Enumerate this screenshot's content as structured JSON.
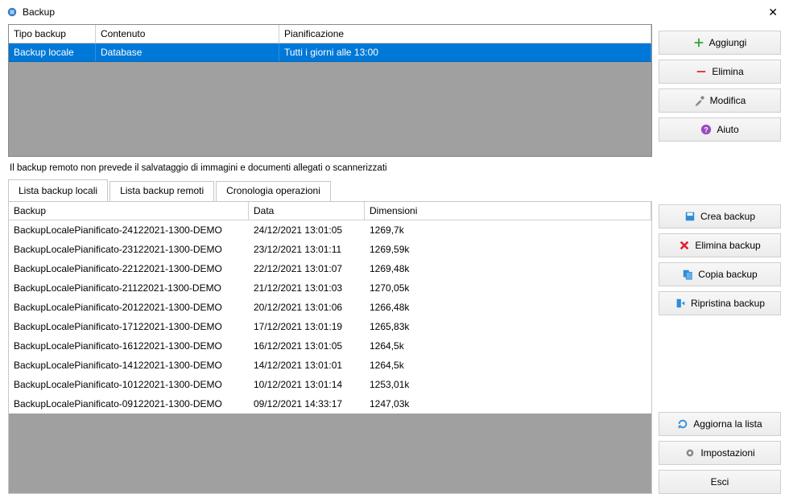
{
  "window": {
    "title": "Backup"
  },
  "top_table": {
    "headers": {
      "tipo": "Tipo backup",
      "contenuto": "Contenuto",
      "pianificazione": "Pianificazione"
    },
    "row": {
      "tipo": "Backup locale",
      "contenuto": "Database",
      "pianificazione": "Tutti i giorni alle 13:00"
    }
  },
  "note": "Il backup remoto non prevede il salvataggio di immagini e documenti allegati o scannerizzati",
  "tabs": {
    "locali": "Lista backup locali",
    "remoti": "Lista backup remoti",
    "cronologia": "Cronologia operazioni"
  },
  "list": {
    "headers": {
      "backup": "Backup",
      "data": "Data",
      "dimensioni": "Dimensioni"
    },
    "rows": [
      {
        "backup": "BackupLocalePianificato-24122021-1300-DEMO",
        "data": "24/12/2021 13:01:05",
        "dim": "1269,7k"
      },
      {
        "backup": "BackupLocalePianificato-23122021-1300-DEMO",
        "data": "23/12/2021 13:01:11",
        "dim": "1269,59k"
      },
      {
        "backup": "BackupLocalePianificato-22122021-1300-DEMO",
        "data": "22/12/2021 13:01:07",
        "dim": "1269,48k"
      },
      {
        "backup": "BackupLocalePianificato-21122021-1300-DEMO",
        "data": "21/12/2021 13:01:03",
        "dim": "1270,05k"
      },
      {
        "backup": "BackupLocalePianificato-20122021-1300-DEMO",
        "data": "20/12/2021 13:01:06",
        "dim": "1266,48k"
      },
      {
        "backup": "BackupLocalePianificato-17122021-1300-DEMO",
        "data": "17/12/2021 13:01:19",
        "dim": "1265,83k"
      },
      {
        "backup": "BackupLocalePianificato-16122021-1300-DEMO",
        "data": "16/12/2021 13:01:05",
        "dim": "1264,5k"
      },
      {
        "backup": "BackupLocalePianificato-14122021-1300-DEMO",
        "data": "14/12/2021 13:01:01",
        "dim": "1264,5k"
      },
      {
        "backup": "BackupLocalePianificato-10122021-1300-DEMO",
        "data": "10/12/2021 13:01:14",
        "dim": "1253,01k"
      },
      {
        "backup": "BackupLocalePianificato-09122021-1300-DEMO",
        "data": "09/12/2021 14:33:17",
        "dim": "1247,03k"
      }
    ]
  },
  "buttons": {
    "aggiungi": "Aggiungi",
    "elimina": "Elimina",
    "modifica": "Modifica",
    "aiuto": "Aiuto",
    "crea": "Crea backup",
    "elimina_backup": "Elimina backup",
    "copia": "Copia backup",
    "ripristina": "Ripristina backup",
    "aggiorna": "Aggiorna la lista",
    "impostazioni": "Impostazioni",
    "esci": "Esci"
  }
}
